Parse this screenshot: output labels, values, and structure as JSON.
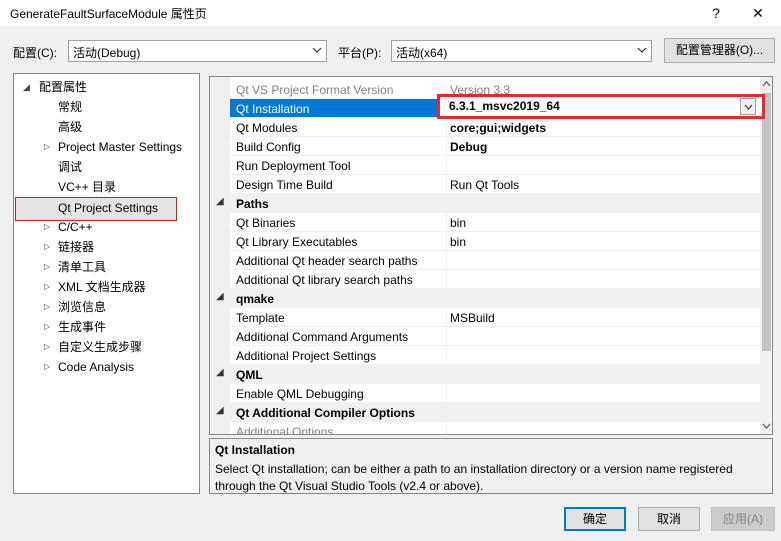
{
  "window": {
    "title": "GenerateFaultSurfaceModule 属性页",
    "help_btn": "?",
    "close_btn": "✕"
  },
  "config": {
    "label": "配置(C):",
    "value": "活动(Debug)"
  },
  "platform": {
    "label": "平台(P):",
    "value": "活动(x64)"
  },
  "manager_btn": "配置管理器(O)...",
  "tree": {
    "root": "配置属性",
    "items": [
      {
        "label": "常规",
        "expandable": false
      },
      {
        "label": "高级",
        "expandable": false
      },
      {
        "label": "Project Master Settings",
        "expandable": true
      },
      {
        "label": "调试",
        "expandable": false
      },
      {
        "label": "VC++ 目录",
        "expandable": false
      },
      {
        "label": "Qt Project Settings",
        "expandable": false,
        "selected": true
      },
      {
        "label": "C/C++",
        "expandable": true
      },
      {
        "label": "链接器",
        "expandable": true
      },
      {
        "label": "清单工具",
        "expandable": true
      },
      {
        "label": "XML 文档生成器",
        "expandable": true
      },
      {
        "label": "浏览信息",
        "expandable": true
      },
      {
        "label": "生成事件",
        "expandable": true
      },
      {
        "label": "自定义生成步骤",
        "expandable": true
      },
      {
        "label": "Code Analysis",
        "expandable": true
      }
    ]
  },
  "grid": {
    "rows": [
      {
        "kind": "prop",
        "name": "Qt VS Project Format Version",
        "value": "Version 3.3",
        "style": "grey"
      },
      {
        "kind": "prop",
        "name": "Qt Installation",
        "value": "6.3.1_msvc2019_64",
        "style": "selected"
      },
      {
        "kind": "prop",
        "name": "Qt Modules",
        "value": "core;gui;widgets",
        "style": "bold"
      },
      {
        "kind": "prop",
        "name": "Build Config",
        "value": "Debug",
        "style": "bold"
      },
      {
        "kind": "prop",
        "name": "Run Deployment Tool",
        "value": "",
        "style": ""
      },
      {
        "kind": "prop",
        "name": "Design Time Build",
        "value": "Run Qt Tools",
        "style": ""
      },
      {
        "kind": "cat",
        "name": "Paths"
      },
      {
        "kind": "prop",
        "name": "Qt Binaries",
        "value": "bin",
        "style": ""
      },
      {
        "kind": "prop",
        "name": "Qt Library Executables",
        "value": "bin",
        "style": ""
      },
      {
        "kind": "prop",
        "name": "Additional Qt header search paths",
        "value": "",
        "style": ""
      },
      {
        "kind": "prop",
        "name": "Additional Qt library search paths",
        "value": "",
        "style": ""
      },
      {
        "kind": "cat",
        "name": "qmake"
      },
      {
        "kind": "prop",
        "name": "Template",
        "value": "MSBuild",
        "style": ""
      },
      {
        "kind": "prop",
        "name": "Additional Command Arguments",
        "value": "",
        "style": ""
      },
      {
        "kind": "prop",
        "name": "Additional Project Settings",
        "value": "",
        "style": ""
      },
      {
        "kind": "cat",
        "name": "QML"
      },
      {
        "kind": "prop",
        "name": "Enable QML Debugging",
        "value": "",
        "style": ""
      },
      {
        "kind": "cat",
        "name": "Qt Additional Compiler Options"
      },
      {
        "kind": "prop",
        "name": "Additional Options",
        "value": "",
        "style": "grey"
      }
    ]
  },
  "description": {
    "title": "Qt Installation",
    "body": "Select Qt installation; can be either a path to an installation directory or a version name registered through the Qt Visual Studio Tools (v2.4 or above)."
  },
  "buttons": {
    "ok": "确定",
    "cancel": "取消",
    "apply": "应用(A)"
  },
  "colors": {
    "selection": "#0078d7",
    "highlight_red": "#e8292a"
  }
}
